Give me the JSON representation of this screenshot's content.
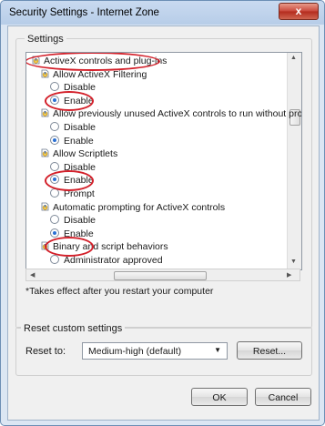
{
  "window": {
    "title": "Security Settings - Internet Zone",
    "close_label": "x"
  },
  "settings": {
    "group_label": "Settings",
    "tree": [
      {
        "id": "activex",
        "label": "ActiveX controls and plug-ins",
        "kind": "category",
        "checked": null
      },
      {
        "id": "filtering",
        "label": "Allow ActiveX Filtering",
        "kind": "setting",
        "checked": null
      },
      {
        "id": "filtering-disable",
        "label": "Disable",
        "kind": "option",
        "checked": false
      },
      {
        "id": "filtering-enable",
        "label": "Enable",
        "kind": "option",
        "checked": true
      },
      {
        "id": "previously",
        "label": "Allow previously unused ActiveX controls to run without prom",
        "kind": "setting",
        "checked": null
      },
      {
        "id": "previously-disable",
        "label": "Disable",
        "kind": "option",
        "checked": false
      },
      {
        "id": "previously-enable",
        "label": "Enable",
        "kind": "option",
        "checked": true
      },
      {
        "id": "scriptlets",
        "label": "Allow Scriptlets",
        "kind": "setting",
        "checked": null
      },
      {
        "id": "scriptlets-disable",
        "label": "Disable",
        "kind": "option",
        "checked": false
      },
      {
        "id": "scriptlets-enable",
        "label": "Enable",
        "kind": "option",
        "checked": true
      },
      {
        "id": "scriptlets-prompt",
        "label": "Prompt",
        "kind": "option",
        "checked": false
      },
      {
        "id": "autoprompt",
        "label": "Automatic prompting for ActiveX controls",
        "kind": "setting",
        "checked": null
      },
      {
        "id": "autoprompt-disable",
        "label": "Disable",
        "kind": "option",
        "checked": false
      },
      {
        "id": "autoprompt-enable",
        "label": "Enable",
        "kind": "option",
        "checked": true
      },
      {
        "id": "binary",
        "label": "Binary and script behaviors",
        "kind": "setting",
        "checked": null
      },
      {
        "id": "binary-admin",
        "label": "Administrator approved",
        "kind": "option",
        "checked": false
      }
    ],
    "note": "*Takes effect after you restart your computer"
  },
  "reset": {
    "group_label": "Reset custom settings",
    "label": "Reset to:",
    "selected": "Medium-high (default)",
    "reset_button": "Reset..."
  },
  "buttons": {
    "ok": "OK",
    "cancel": "Cancel"
  },
  "colors": {
    "highlight_ring": "#d3202a",
    "radio_dot": "#2a6fd3",
    "title_bar": "#c9daf0"
  }
}
